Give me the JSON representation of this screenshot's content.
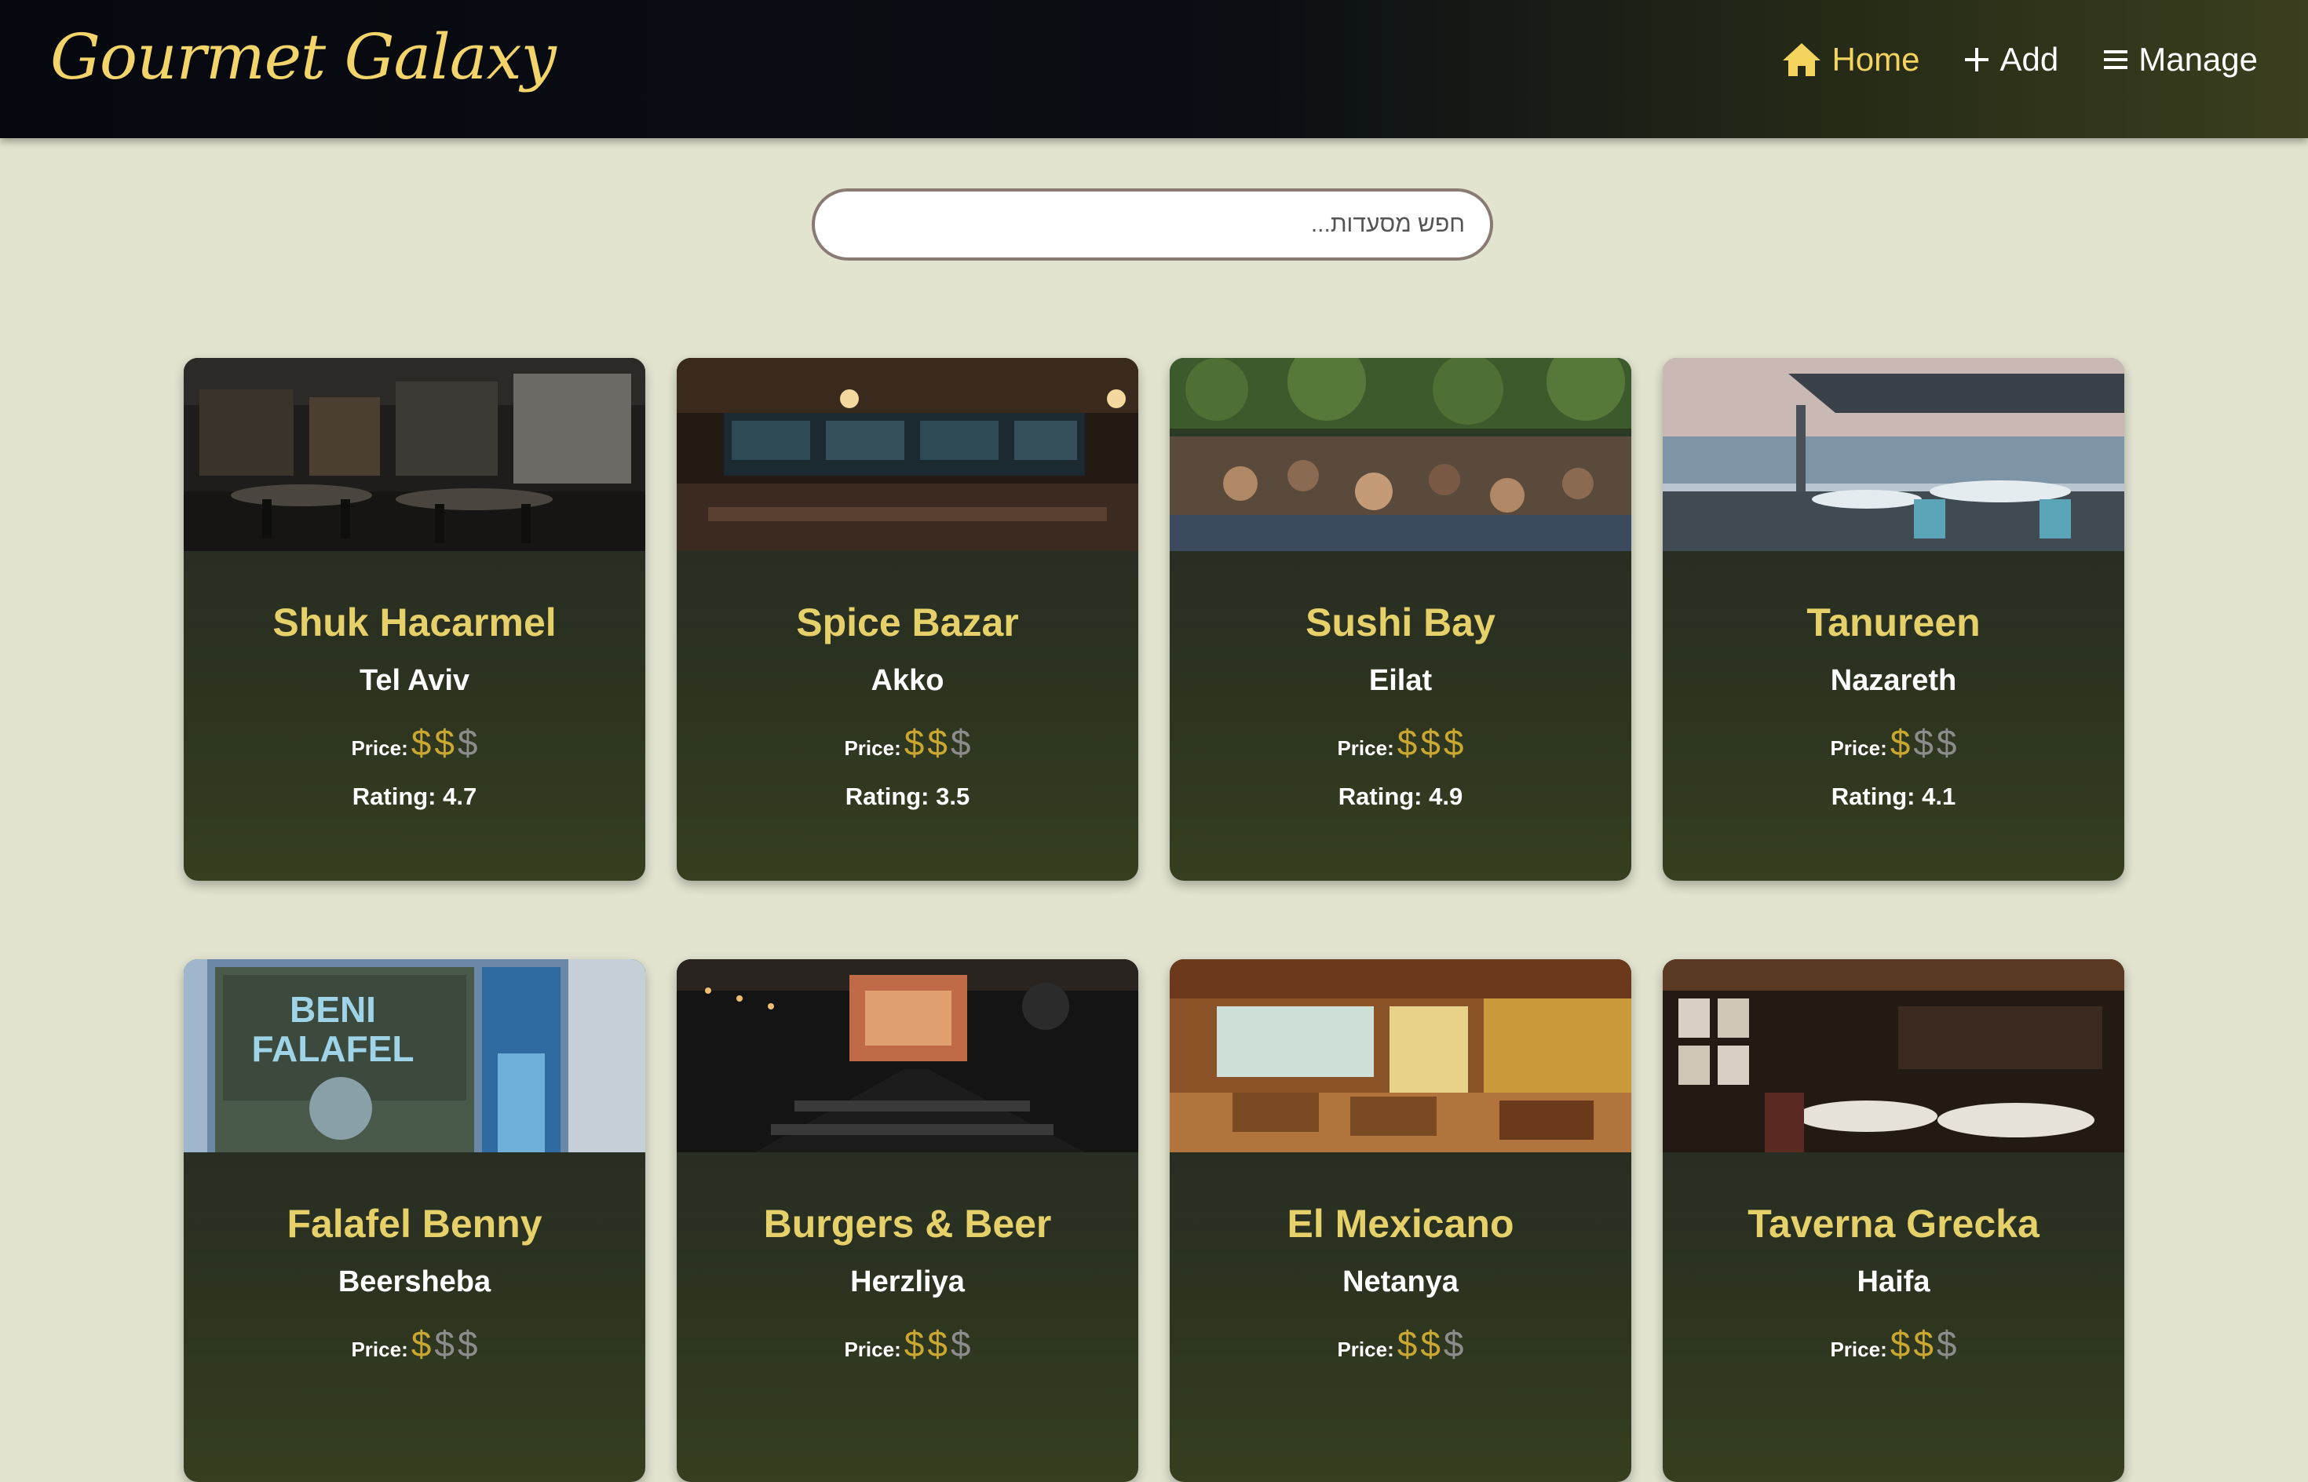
{
  "header": {
    "logo": "Gourmet Galaxy",
    "nav": [
      {
        "label": "Home",
        "icon": "home-icon",
        "active": true
      },
      {
        "label": "Add",
        "icon": "plus-icon",
        "active": false
      },
      {
        "label": "Manage",
        "icon": "menu-icon",
        "active": false
      }
    ]
  },
  "search": {
    "placeholder": "חפש מסעדות..."
  },
  "price_label": "Price:",
  "rating_label": "Rating:",
  "colors": {
    "accent": "#f4d35e",
    "card_title": "#e6d06a",
    "price_on": "#c9a731",
    "price_off": "#8c8c8c"
  },
  "restaurants": [
    {
      "name": "Shuk Hacarmel",
      "city": "Tel Aviv",
      "price_level": 2,
      "price_max": 3,
      "rating": "4.7"
    },
    {
      "name": "Spice Bazar",
      "city": "Akko",
      "price_level": 2,
      "price_max": 3,
      "rating": "3.5"
    },
    {
      "name": "Sushi Bay",
      "city": "Eilat",
      "price_level": 3,
      "price_max": 3,
      "rating": "4.9"
    },
    {
      "name": "Tanureen",
      "city": "Nazareth",
      "price_level": 1,
      "price_max": 3,
      "rating": "4.1"
    },
    {
      "name": "Falafel Benny",
      "city": "Beersheba",
      "price_level": 1,
      "price_max": 3,
      "rating": ""
    },
    {
      "name": "Burgers & Beer",
      "city": "Herzliya",
      "price_level": 2,
      "price_max": 3,
      "rating": ""
    },
    {
      "name": "El Mexicano",
      "city": "Netanya",
      "price_level": 2,
      "price_max": 3,
      "rating": ""
    },
    {
      "name": "Taverna Grecka",
      "city": "Haifa",
      "price_level": 2,
      "price_max": 3,
      "rating": ""
    }
  ]
}
